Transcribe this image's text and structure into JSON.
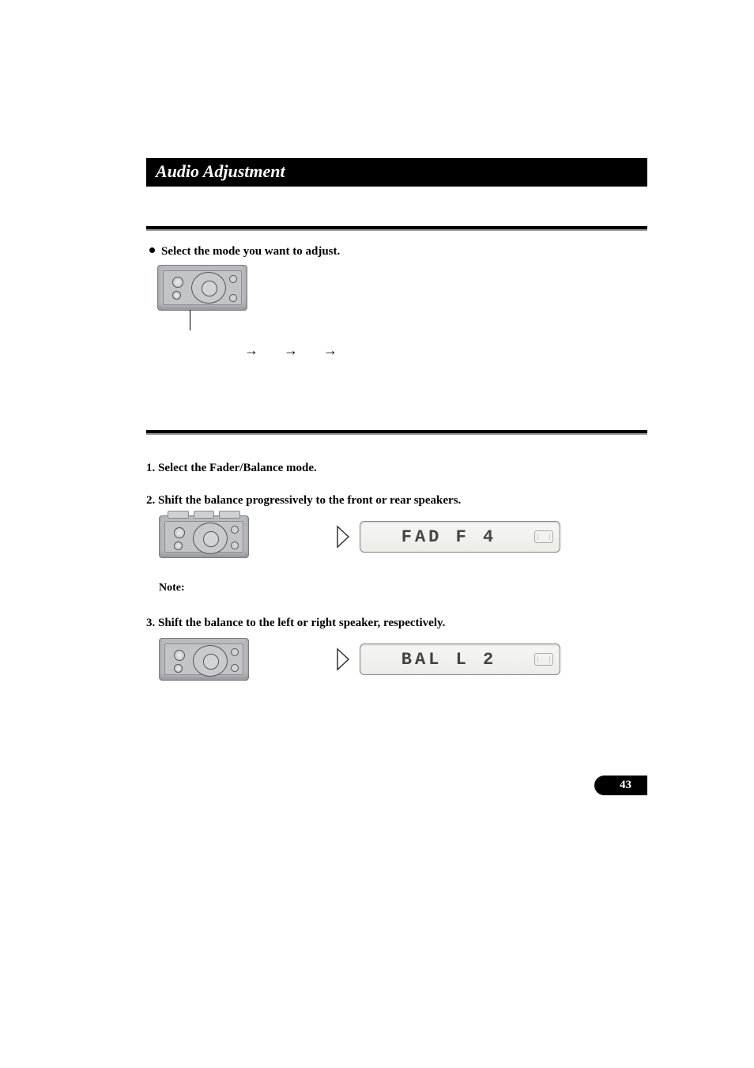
{
  "chapter_title": "Audio Adjustment",
  "select_mode": {
    "bullet_text": "Select the mode you want to adjust."
  },
  "fader_balance": {
    "step1": "1. Select the Fader/Balance mode.",
    "step2": "2. Shift the balance progressively to the front or rear speakers.",
    "lcd_fad": "FAD F 4",
    "note_label": "Note:",
    "step3": "3. Shift the balance to the left or right speaker, respectively.",
    "lcd_bal": "BAL L 2"
  },
  "page_number": "43"
}
